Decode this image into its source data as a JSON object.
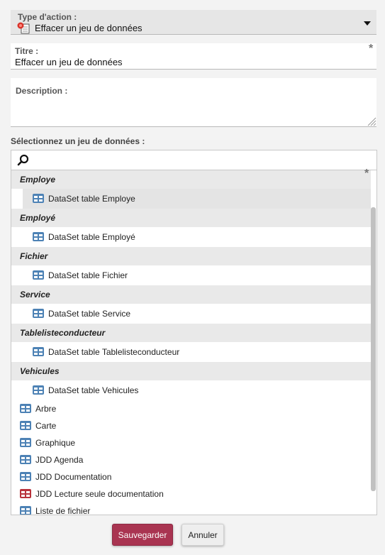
{
  "action": {
    "label": "Type d'action :",
    "value": "Effacer un jeu de données",
    "icon": "eraser-icon"
  },
  "title_field": {
    "label": "Titre :",
    "value": "Effacer un jeu de données",
    "required_mark": "*"
  },
  "description_field": {
    "label": "Description :",
    "value": ""
  },
  "dataset": {
    "label": "Sélectionnez un jeu de données :",
    "search_placeholder": "",
    "required_mark": "*",
    "groups": [
      {
        "name": "Employe",
        "items": [
          "DataSet table Employe"
        ]
      },
      {
        "name": "Employé",
        "items": [
          "DataSet table Employé"
        ]
      },
      {
        "name": "Fichier",
        "items": [
          "DataSet table Fichier"
        ]
      },
      {
        "name": "Service",
        "items": [
          "DataSet table Service"
        ]
      },
      {
        "name": "Tablelisteconducteur",
        "items": [
          "DataSet table Tablelisteconducteur"
        ]
      },
      {
        "name": "Vehicules",
        "items": [
          "DataSet table Vehicules"
        ]
      }
    ],
    "selected": "DataSet table Employe",
    "root_items": [
      {
        "label": "Arbre",
        "icon_color": "#4d82b5"
      },
      {
        "label": "Carte",
        "icon_color": "#4d82b5"
      },
      {
        "label": "Graphique",
        "icon_color": "#4d82b5"
      },
      {
        "label": "JDD Agenda",
        "icon_color": "#4d82b5"
      },
      {
        "label": "JDD Documentation",
        "icon_color": "#4d82b5"
      },
      {
        "label": "JDD Lecture seule documentation",
        "icon_color": "#b8323b"
      },
      {
        "label": "Liste de fichier",
        "icon_color": "#4d82b5"
      }
    ]
  },
  "buttons": {
    "save": "Sauvegarder",
    "cancel": "Annuler"
  },
  "colors": {
    "primary_button": "#a93451",
    "table_icon": "#4d82b5",
    "readonly_icon": "#b8323b"
  }
}
